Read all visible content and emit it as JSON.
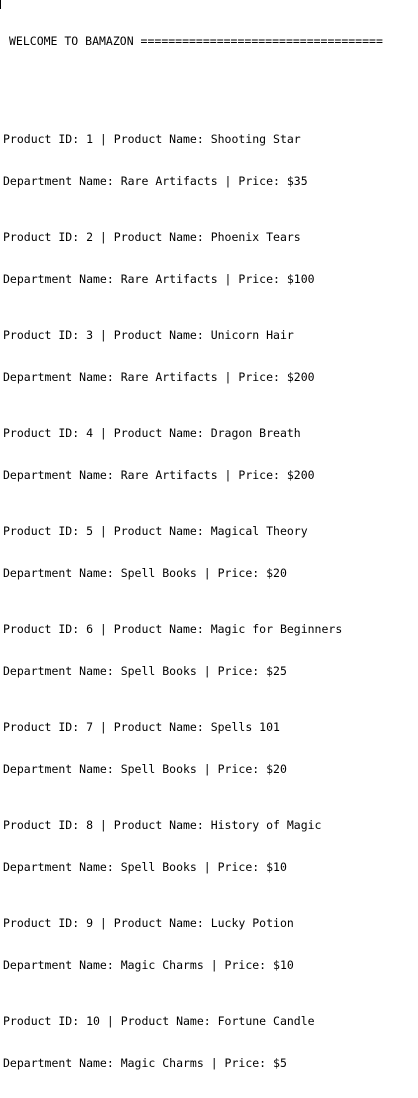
{
  "header": "WELCOME TO BAMAZON ===================================",
  "products": [
    {
      "line1": "Product ID: 1 | Product Name: Shooting Star",
      "line2": "Department Name: Rare Artifacts | Price: $35"
    },
    {
      "line1": "Product ID: 2 | Product Name: Phoenix Tears",
      "line2": "Department Name: Rare Artifacts | Price: $100"
    },
    {
      "line1": "Product ID: 3 | Product Name: Unicorn Hair",
      "line2": "Department Name: Rare Artifacts | Price: $200"
    },
    {
      "line1": "Product ID: 4 | Product Name: Dragon Breath",
      "line2": "Department Name: Rare Artifacts | Price: $200"
    },
    {
      "line1": "Product ID: 5 | Product Name: Magical Theory",
      "line2": "Department Name: Spell Books | Price: $20"
    },
    {
      "line1": "Product ID: 6 | Product Name: Magic for Beginners",
      "line2": "Department Name: Spell Books | Price: $25"
    },
    {
      "line1": "Product ID: 7 | Product Name: Spells 101",
      "line2": "Department Name: Spell Books | Price: $20"
    },
    {
      "line1": "Product ID: 8 | Product Name: History of Magic",
      "line2": "Department Name: Spell Books | Price: $10"
    },
    {
      "line1": "Product ID: 9 | Product Name: Lucky Potion",
      "line2": "Department Name: Magic Charms | Price: $10"
    },
    {
      "line1": "Product ID: 10 | Product Name: Fortune Candle",
      "line2": "Department Name: Magic Charms | Price: $5"
    }
  ]
}
